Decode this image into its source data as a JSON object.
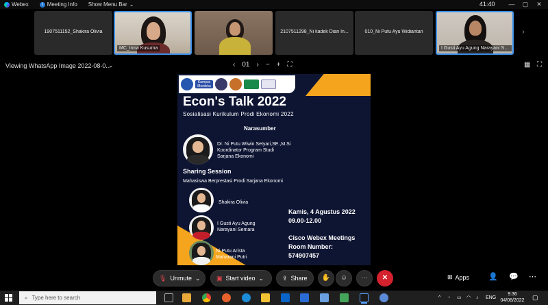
{
  "titlebar": {
    "app_name": "Webex",
    "meeting_info": "Meeting Info",
    "show_menu": "Show Menu Bar",
    "show_menu_chevron": "⌄",
    "time": "41:40",
    "minimize": "—",
    "maximize": "▢",
    "close": "✕"
  },
  "participants": [
    {
      "name": "1907511152_Shakira Olivia",
      "video": false
    },
    {
      "name": "MC_Irma Kusuma",
      "video": true,
      "active": true
    },
    {
      "name": "",
      "video": true
    },
    {
      "name": "2107511298_Ni kadek Dian In...",
      "video": false
    },
    {
      "name": "010_Ni Putu Ayu Widiantari",
      "video": false
    },
    {
      "name": "I Gusti Ayu Agung Narayani Se...",
      "video": true,
      "active": true
    }
  ],
  "viewbar": {
    "label": "Viewing WhatsApp Image 2022-08-0...",
    "chevron": "⌄",
    "page_prev": "‹",
    "page": "01",
    "page_next": "›",
    "zoom_out": "−",
    "zoom_in": "+",
    "fit": "⛶"
  },
  "poster": {
    "logo_text": "Kampus Merdeka",
    "title": "Econ's Talk 2022",
    "subtitle": "Sosialisasi Kurikulum Prodi Ekonomi 2022",
    "narasumber_heading": "Narasumber",
    "speaker": "Dr. Ni Putu Wiwin Setyari,SE.,M.Si\nKoordinator Program Studi\nSarjana Ekonomi",
    "sharing_heading": "Sharing Session",
    "sharing_sub": "Mahasiswa Berprestasi Prodi Sarjana Ekonomi",
    "students": [
      "Shakira Olivia",
      "I Gusti Ayu Agung\nNarayani Semara",
      "Ni Putu Arista\nMaharani Putri"
    ],
    "date": "Kamis, 4 Agustus 2022",
    "time": "09.00-12.00",
    "platform": "Cisco Webex Meetings",
    "room_label": "Room Number:",
    "room_number": "574907457"
  },
  "controls": {
    "unmute": "Unmute",
    "start_video": "Start video",
    "share": "Share",
    "apps": "Apps",
    "caret": "⌄",
    "more": "···",
    "end": "✕"
  },
  "taskbar": {
    "search_placeholder": "Type here to search",
    "tray_lang": "ENG",
    "clock_time": "9:36",
    "clock_date": "04/08/2022",
    "tray_chevron": "^"
  }
}
